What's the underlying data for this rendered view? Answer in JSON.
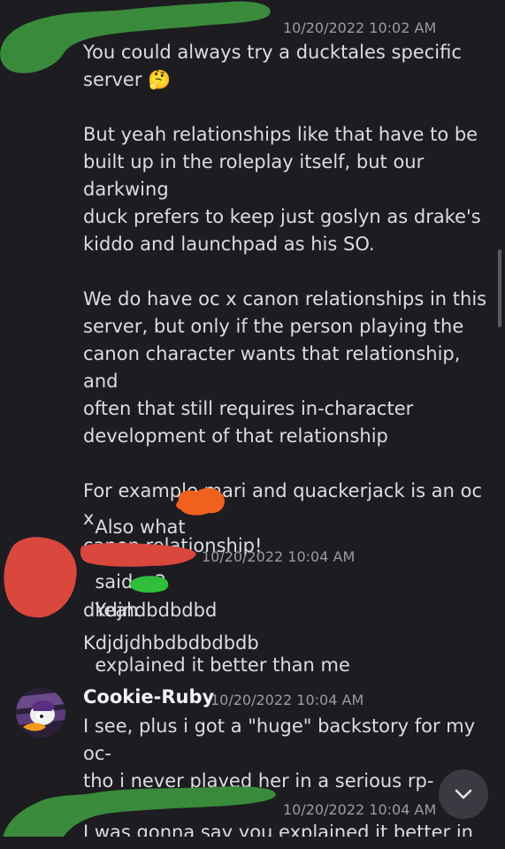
{
  "messages": [
    {
      "timestamp": "10/20/2022 10:02 AM",
      "lines": [
        "You could always try a ducktales specific",
        "server 🤔",
        "",
        "But yeah relationships like that have to be",
        "built up in the roleplay itself, but our darkwing",
        "duck prefers to keep just goslyn as drake's",
        "kiddo and launchpad as his SO.",
        "",
        "We do have oc x canon relationships in this",
        "server, but only if the person playing the",
        "canon character wants that relationship, and",
        "often that still requires in-character",
        "development of that relationship",
        "",
        "For example mari and quackerjack is an oc x",
        "canon relationship!"
      ],
      "followup_before": "Also what",
      "followup_after": "said <3"
    },
    {
      "timestamp": "10/20/2022 10:04 AM",
      "line1_before": "Yeah",
      "line1_after": "explained it better than me",
      "line2": "dkdjndbdbdbd",
      "followup": "Kdjdjdhbdbdbdbdb"
    },
    {
      "author": "Cookie-Ruby",
      "timestamp": "10/20/2022 10:04 AM",
      "lines": [
        "I see, plus i got a \"huge\" backstory for my oc-",
        "tho i never played her in a serious rp-"
      ]
    },
    {
      "timestamp": "10/20/2022 10:04 AM",
      "partial_line": "I was gonna say you explained it better in"
    }
  ],
  "icons": {
    "jump": "chevron-down-icon",
    "avatar": "duck-avatar-icon"
  },
  "colors": {
    "background": "#1c1c21",
    "text": "#dcdde1",
    "timestamp": "#9b9ca3",
    "redact_green": "#3a8a3c",
    "redact_orange": "#f0611e",
    "redact_red": "#d9473d",
    "redact_bright_green": "#2fbf3a"
  }
}
